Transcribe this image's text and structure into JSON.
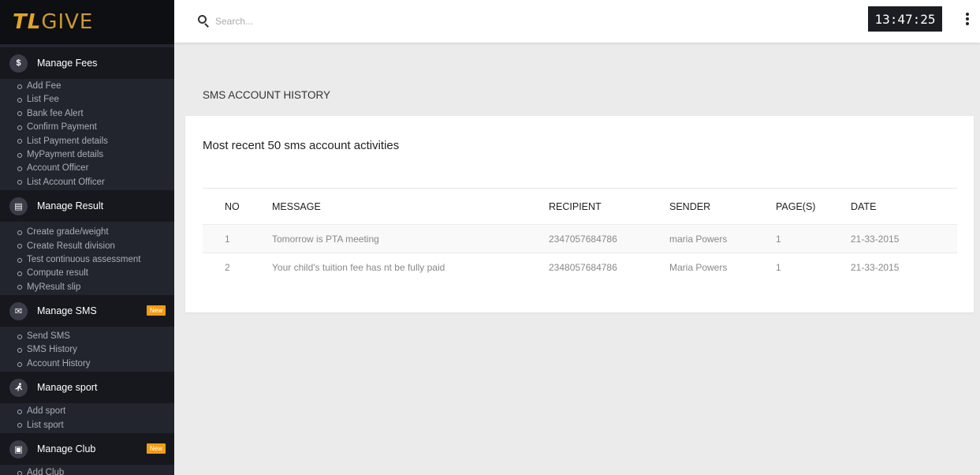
{
  "logo": {
    "part1": "TL",
    "part2": "GIVE"
  },
  "sidebar": {
    "sections": [
      {
        "icon": "dollar-icon",
        "icon_glyph": "$",
        "title": "Manage Fees",
        "items": [
          "Add Fee",
          "List Fee",
          "Bank fee Alert",
          "Confirm Payment",
          "List Payment details",
          "MyPayment details",
          "Account Officer",
          "List Account Officer"
        ]
      },
      {
        "icon": "document-icon",
        "icon_glyph": "▤",
        "title": "Manage Result",
        "items": [
          "Create grade/weight",
          "Create Result division",
          "Test continuous assessment",
          "Compute result",
          "MyResult slip"
        ]
      },
      {
        "icon": "envelope-icon",
        "icon_glyph": "✉",
        "title": "Manage SMS",
        "badge": "New",
        "items": [
          "Send SMS",
          "SMS History",
          "Account History"
        ]
      },
      {
        "icon": "runner-icon",
        "icon_glyph": "🏃",
        "title": "Manage sport",
        "items": [
          "Add sport",
          "List sport"
        ]
      },
      {
        "icon": "club-icon",
        "icon_glyph": "▣",
        "title": "Manage Club",
        "badge": "New",
        "items": [
          "Add Club"
        ]
      }
    ]
  },
  "topbar": {
    "search_placeholder": "Search...",
    "clock": "13:47:25"
  },
  "page": {
    "title": "SMS ACCOUNT HISTORY",
    "card_title": "Most recent 50 sms account activities",
    "table": {
      "headers": [
        "NO",
        "MESSAGE",
        "RECIPIENT",
        "SENDER",
        "PAGE(S)",
        "DATE"
      ],
      "rows": [
        [
          "1",
          "Tomorrow is PTA meeting",
          "2347057684786",
          "maria Powers",
          "1",
          "21-33-2015"
        ],
        [
          "2",
          "Your child's tuition fee has nt be fully paid",
          "2348057684786",
          "Maria Powers",
          "1",
          "21-33-2015"
        ]
      ]
    }
  }
}
